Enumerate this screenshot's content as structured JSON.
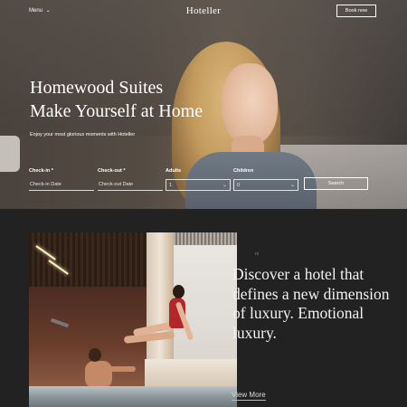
{
  "header": {
    "menu_label": "Menu",
    "brand": "Hoteller",
    "book_label": "Book now"
  },
  "hero": {
    "title_line1": "Homewood Suites",
    "title_line2": "Make Yourself at Home",
    "subtitle": "Enjoy your most glorious moments with Hoteller"
  },
  "booking": {
    "checkin_label": "Check-in",
    "checkin_placeholder": "Check-in Date",
    "checkout_label": "Check-out",
    "checkout_placeholder": "Check-out Date",
    "adults_label": "Adults",
    "adults_value": "1",
    "children_label": "Children",
    "children_value": "0",
    "search_label": "Search"
  },
  "feature": {
    "partial_label": "rs",
    "tagline": "Discover a hotel that defines a new dimension of luxury. Emotional luxury.",
    "view_more": "View More"
  },
  "colors": {
    "dark_bg": "#232222",
    "accent_text": "#ffffff"
  }
}
